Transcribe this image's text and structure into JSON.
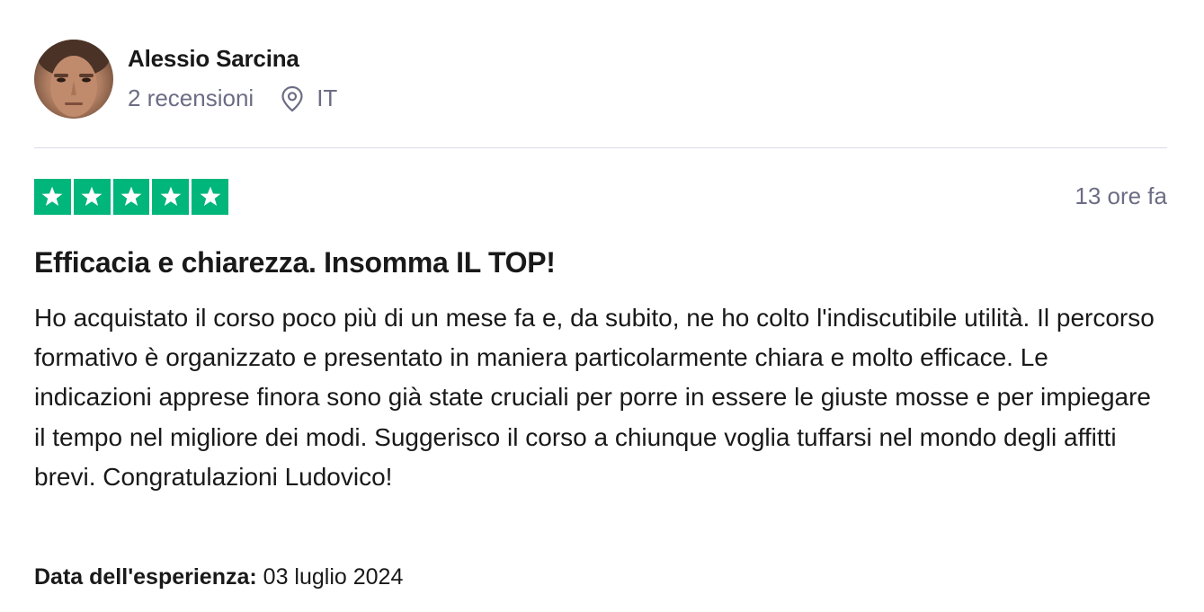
{
  "reviewer": {
    "name": "Alessio Sarcina",
    "reviews_count": "2 recensioni",
    "country": "IT",
    "avatar_icon": "avatar-photo"
  },
  "review": {
    "rating": 5,
    "rating_max": 5,
    "star_color": "#00b67a",
    "date": "13 ore fa",
    "title": "Efficacia e chiarezza. Insomma IL TOP!",
    "body": "Ho acquistato il corso poco più di un mese fa e, da subito, ne ho colto l'indiscutibile utilità. Il percorso formativo è organizzato e presentato in maniera particolarmente chiara e molto efficace. Le indicazioni apprese finora sono già state cruciali per porre in essere le giuste mosse e per impiegare il tempo nel migliore dei modi. Suggerisco il corso a chiunque voglia tuffarsi nel mondo degli affitti brevi. Congratulazioni Ludovico!",
    "experience_label": "Data dell'esperienza:",
    "experience_date": "03 luglio 2024"
  },
  "icons": {
    "location": "location-pin-icon",
    "star": "star-icon"
  }
}
